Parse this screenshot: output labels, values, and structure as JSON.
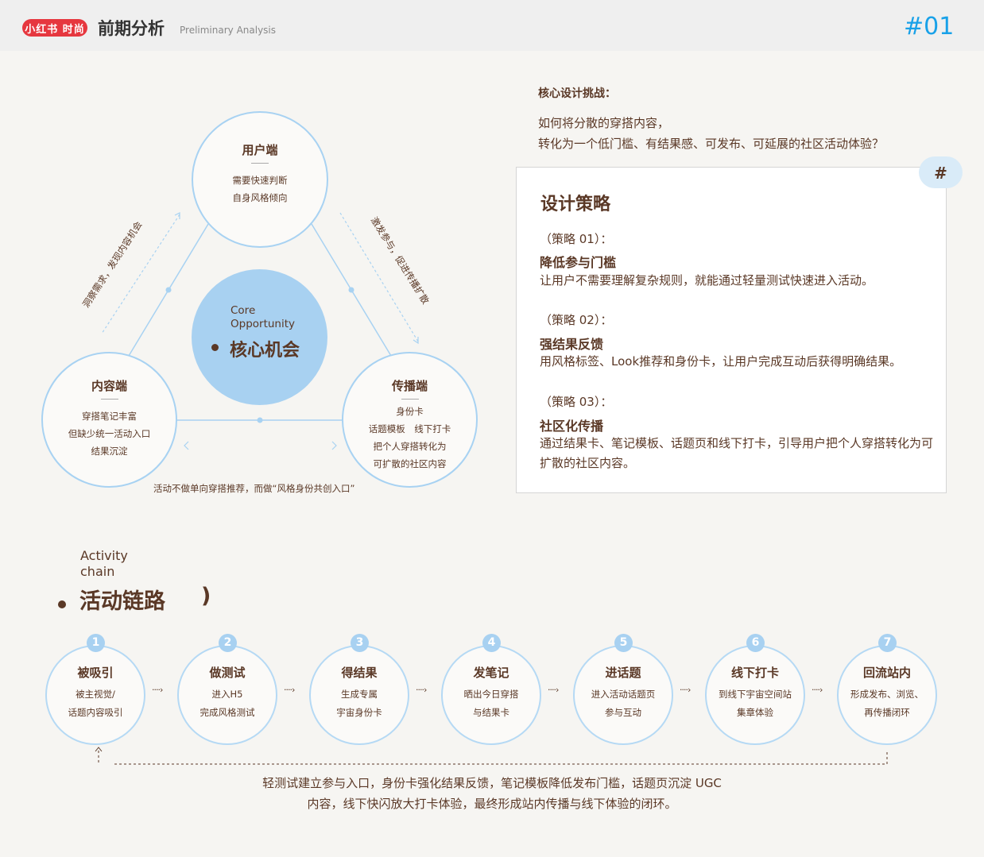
{
  "header": {
    "logo": "小红书 时尚",
    "title": "前期分析",
    "subtitle": "Preliminary Analysis",
    "page_number": "#01"
  },
  "diagram": {
    "user": {
      "title": "用户端",
      "lines": [
        "需要快速判断",
        "自身风格倾向"
      ]
    },
    "content": {
      "title": "内容端",
      "lines": [
        "穿搭笔记丰富",
        "但缺少统一活动入口",
        "结果沉淀"
      ]
    },
    "spread": {
      "title": "传播端",
      "lines": [
        "身份卡",
        "话题模板　线下打卡",
        "把个人穿搭转化为",
        "可扩散的社区内容"
      ]
    },
    "core": {
      "en_line1": "Core",
      "en_line2": "Opportunity",
      "zh": "核心机会"
    },
    "left_edge_text": "洞察需求，发现内容机会",
    "right_edge_text": "激发参与，促进传播扩散",
    "bottom_note": "活动不做单向穿搭推荐，而做“风格身份共创入口”"
  },
  "challenge": {
    "heading": "核心设计挑战：",
    "line1": "如何将分散的穿搭内容，",
    "line2": "转化为一个低门槛、有结果感、可发布、可延展的社区活动体验？"
  },
  "strategy": {
    "hash": "#",
    "title": "设计策略",
    "items": [
      {
        "tag": "（策略 01）：",
        "name": "降低参与门槛",
        "desc": "让用户不需要理解复杂规则，就能通过轻量测试快速进入活动。"
      },
      {
        "tag": "（策略 02）：",
        "name": "强结果反馈",
        "desc": "用风格标签、Look推荐和身份卡，让用户完成互动后获得明确结果。"
      },
      {
        "tag": "（策略 03）：",
        "name": "社区化传播",
        "desc": "通过结果卡、笔记模板、话题页和线下打卡，引导用户把个人穿搭转化为可扩散的社区内容。"
      }
    ]
  },
  "activity": {
    "en_line1": "Activity",
    "en_line2": "chain",
    "zh": "活动链路",
    "paren": ")",
    "arrow": "····›",
    "steps": [
      {
        "num": "1",
        "title": "被吸引",
        "line1": "被主视觉/",
        "line2": "话题内容吸引"
      },
      {
        "num": "2",
        "title": "做测试",
        "line1": "进入H5",
        "line2": "完成风格测试"
      },
      {
        "num": "3",
        "title": "得结果",
        "line1": "生成专属",
        "line2": "宇宙身份卡"
      },
      {
        "num": "4",
        "title": "发笔记",
        "line1": "晒出今日穿搭",
        "line2": "与结果卡"
      },
      {
        "num": "5",
        "title": "进话题",
        "line1": "进入活动话题页",
        "line2": "参与互动"
      },
      {
        "num": "6",
        "title": "线下打卡",
        "line1": "到线下宇宙空间站",
        "line2": "集章体验"
      },
      {
        "num": "7",
        "title": "回流站内",
        "line1": "形成发布、浏览、",
        "line2": "再传播闭环"
      }
    ],
    "summary_line1": "轻测试建立参与入口，身份卡强化结果反馈，笔记模板降低发布门槛，话题页沉淀 UGC",
    "summary_line2": "内容，线下快闪放大打卡体验，最终形成站内传播与线下体验的闭环。"
  },
  "colors": {
    "brown": "#5a3826",
    "light_blue": "#a8d1f1",
    "blue_accent": "#18a1e8",
    "logo_red": "#e6373f"
  }
}
